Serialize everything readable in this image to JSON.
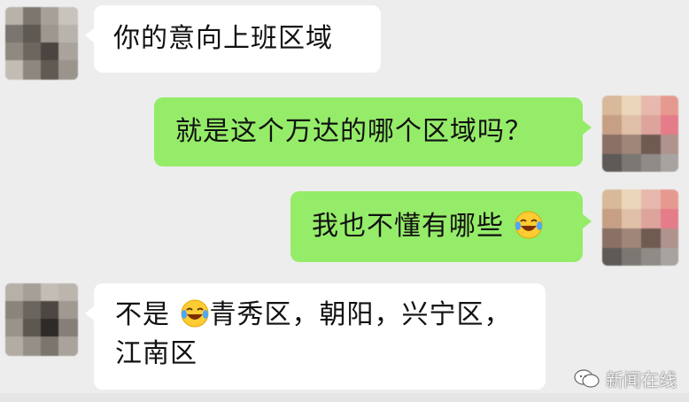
{
  "messages": [
    {
      "side": "left",
      "text": "你的意向上班区域"
    },
    {
      "side": "right",
      "text": "就是这个万达的哪个区域吗？"
    },
    {
      "side": "right",
      "text": "我也不懂有哪些"
    },
    {
      "side": "left",
      "text_part1": "不是",
      "text_part2": "青秀区，朝阳，兴宁区，",
      "text_line2": "江南区"
    }
  ],
  "emoji_name": "laughing-crying-emoji",
  "watermark": {
    "text": "新闻在线",
    "icon": "wechat-logo-icon"
  }
}
